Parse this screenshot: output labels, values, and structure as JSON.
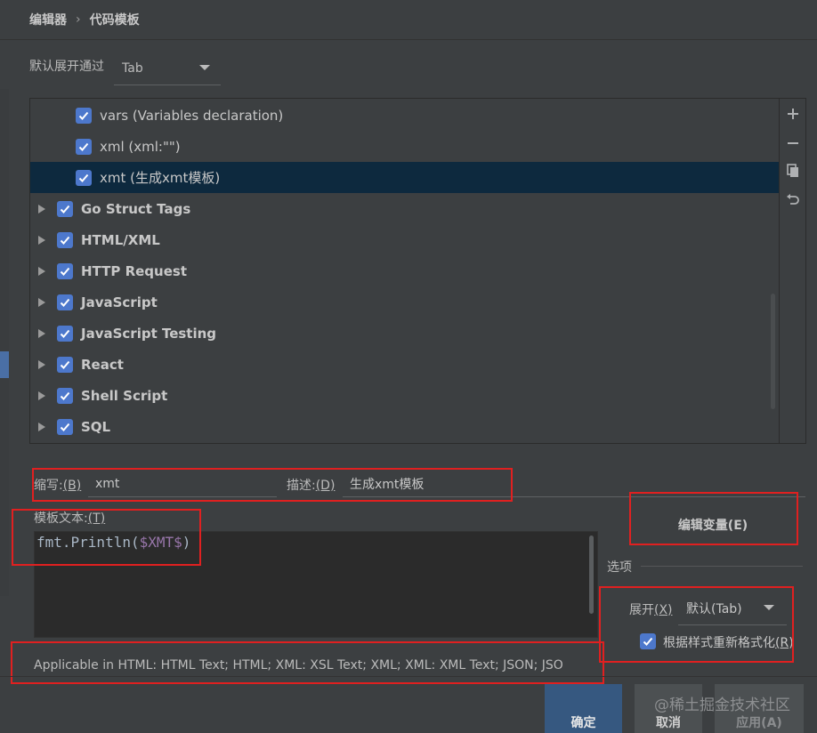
{
  "breadcrumb": {
    "parent": "编辑器",
    "separator": "›",
    "current": "代码模板"
  },
  "expand_by": {
    "label": "默认展开通过",
    "value": "Tab"
  },
  "tree": {
    "children": [
      {
        "label": "vars (Variables declaration)",
        "checked": true
      },
      {
        "label": "xml (xml:\"\")",
        "checked": true
      },
      {
        "label": "xmt (生成xmt模板)",
        "checked": true,
        "selected": true
      }
    ],
    "groups": [
      {
        "label": "Go Struct Tags",
        "checked": true
      },
      {
        "label": "HTML/XML",
        "checked": true
      },
      {
        "label": "HTTP Request",
        "checked": true
      },
      {
        "label": "JavaScript",
        "checked": true
      },
      {
        "label": "JavaScript Testing",
        "checked": true
      },
      {
        "label": "React",
        "checked": true
      },
      {
        "label": "Shell Script",
        "checked": true
      },
      {
        "label": "SQL",
        "checked": true
      }
    ]
  },
  "toolbar": {
    "add_icon": "plus-icon",
    "remove_icon": "minus-icon",
    "copy_icon": "copy-icon",
    "revert_icon": "undo-icon"
  },
  "abbreviation": {
    "label": "缩写:",
    "mnemonic": "(B)",
    "value": "xmt"
  },
  "description": {
    "label": "描述:",
    "mnemonic": "(D)",
    "value": "生成xmt模板"
  },
  "template_text": {
    "label": "模板文本:",
    "mnemonic": "(T)",
    "code_prefix": "fmt.Println(",
    "code_var": "$XMT$",
    "code_suffix": ")"
  },
  "applicable": "Applicable in HTML: HTML Text; HTML; XML: XSL Text; XML; XML: XML Text; JSON; JSO",
  "edit_vars_button": "编辑变量(E)",
  "options": {
    "title": "选项",
    "expand_label": "展开",
    "expand_mnemonic": "(X)",
    "expand_value": "默认(Tab)",
    "reformat_label": "根据样式重新格式化",
    "reformat_mnemonic": "(R)",
    "reformat_checked": true
  },
  "footer": {
    "ok": "确定",
    "cancel": "取消",
    "apply": "应用(A)",
    "watermark": "@稀土掘金技术社区"
  },
  "colors": {
    "accent": "#4d78cc",
    "selection": "#0d293e",
    "annotation": "#e02020"
  }
}
